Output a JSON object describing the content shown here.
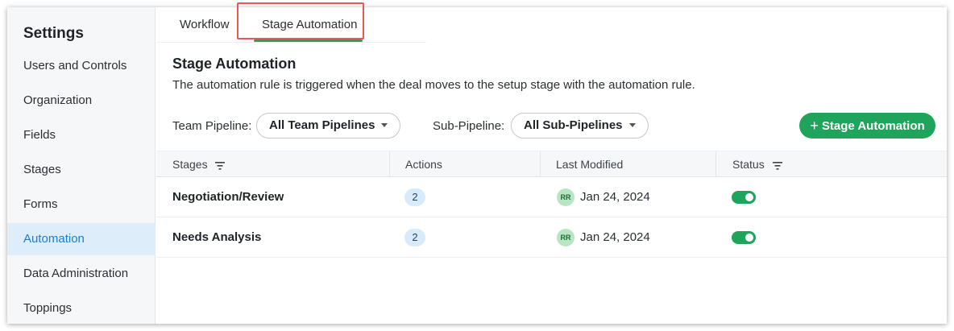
{
  "sidebar": {
    "title": "Settings",
    "items": [
      {
        "label": "Users and Controls",
        "active": false
      },
      {
        "label": "Organization",
        "active": false
      },
      {
        "label": "Fields",
        "active": false
      },
      {
        "label": "Stages",
        "active": false
      },
      {
        "label": "Forms",
        "active": false
      },
      {
        "label": "Automation",
        "active": true
      },
      {
        "label": "Data Administration",
        "active": false
      },
      {
        "label": "Toppings",
        "active": false
      }
    ]
  },
  "tabs": [
    {
      "label": "Workflow",
      "active": false
    },
    {
      "label": "Stage Automation",
      "active": true
    }
  ],
  "main": {
    "title": "Stage Automation",
    "description": "The automation rule is triggered when the deal moves to the setup stage with the automation rule."
  },
  "filters": {
    "team_pipeline_label": "Team Pipeline:",
    "team_pipeline_value": "All Team Pipelines",
    "sub_pipeline_label": "Sub-Pipeline:",
    "sub_pipeline_value": "All Sub-Pipelines"
  },
  "add_button": {
    "icon": "plus-icon",
    "label": "Stage Automation"
  },
  "table": {
    "columns": [
      "Stages",
      "Actions",
      "Last Modified",
      "Status"
    ],
    "rows": [
      {
        "stage": "Negotiation/Review",
        "actions": "2",
        "avatar": "RR",
        "modified": "Jan 24, 2024",
        "status_on": true
      },
      {
        "stage": "Needs Analysis",
        "actions": "2",
        "avatar": "RR",
        "modified": "Jan 24, 2024",
        "status_on": true
      }
    ]
  },
  "colors": {
    "accent_green": "#1fa45b",
    "active_nav_bg": "#ddeefa",
    "active_nav_text": "#1e7cc9",
    "highlight_box": "#e55a57"
  }
}
